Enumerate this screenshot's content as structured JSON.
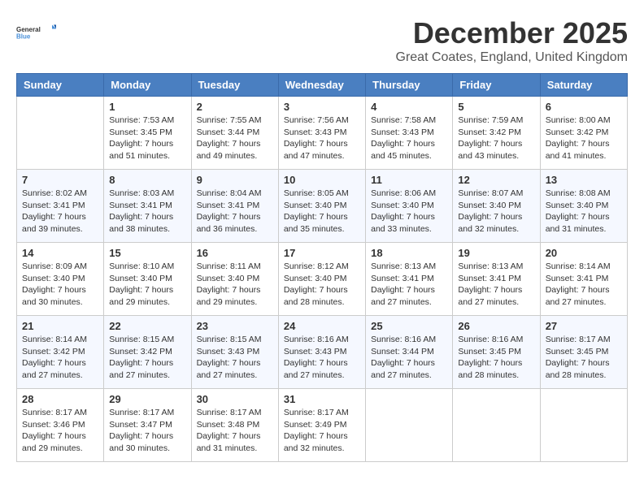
{
  "logo": {
    "text_general": "General",
    "text_blue": "Blue"
  },
  "header": {
    "title": "December 2025",
    "subtitle": "Great Coates, England, United Kingdom"
  },
  "weekdays": [
    "Sunday",
    "Monday",
    "Tuesday",
    "Wednesday",
    "Thursday",
    "Friday",
    "Saturday"
  ],
  "weeks": [
    [
      {
        "day": "",
        "info": ""
      },
      {
        "day": "1",
        "info": "Sunrise: 7:53 AM\nSunset: 3:45 PM\nDaylight: 7 hours\nand 51 minutes."
      },
      {
        "day": "2",
        "info": "Sunrise: 7:55 AM\nSunset: 3:44 PM\nDaylight: 7 hours\nand 49 minutes."
      },
      {
        "day": "3",
        "info": "Sunrise: 7:56 AM\nSunset: 3:43 PM\nDaylight: 7 hours\nand 47 minutes."
      },
      {
        "day": "4",
        "info": "Sunrise: 7:58 AM\nSunset: 3:43 PM\nDaylight: 7 hours\nand 45 minutes."
      },
      {
        "day": "5",
        "info": "Sunrise: 7:59 AM\nSunset: 3:42 PM\nDaylight: 7 hours\nand 43 minutes."
      },
      {
        "day": "6",
        "info": "Sunrise: 8:00 AM\nSunset: 3:42 PM\nDaylight: 7 hours\nand 41 minutes."
      }
    ],
    [
      {
        "day": "7",
        "info": "Sunrise: 8:02 AM\nSunset: 3:41 PM\nDaylight: 7 hours\nand 39 minutes."
      },
      {
        "day": "8",
        "info": "Sunrise: 8:03 AM\nSunset: 3:41 PM\nDaylight: 7 hours\nand 38 minutes."
      },
      {
        "day": "9",
        "info": "Sunrise: 8:04 AM\nSunset: 3:41 PM\nDaylight: 7 hours\nand 36 minutes."
      },
      {
        "day": "10",
        "info": "Sunrise: 8:05 AM\nSunset: 3:40 PM\nDaylight: 7 hours\nand 35 minutes."
      },
      {
        "day": "11",
        "info": "Sunrise: 8:06 AM\nSunset: 3:40 PM\nDaylight: 7 hours\nand 33 minutes."
      },
      {
        "day": "12",
        "info": "Sunrise: 8:07 AM\nSunset: 3:40 PM\nDaylight: 7 hours\nand 32 minutes."
      },
      {
        "day": "13",
        "info": "Sunrise: 8:08 AM\nSunset: 3:40 PM\nDaylight: 7 hours\nand 31 minutes."
      }
    ],
    [
      {
        "day": "14",
        "info": "Sunrise: 8:09 AM\nSunset: 3:40 PM\nDaylight: 7 hours\nand 30 minutes."
      },
      {
        "day": "15",
        "info": "Sunrise: 8:10 AM\nSunset: 3:40 PM\nDaylight: 7 hours\nand 29 minutes."
      },
      {
        "day": "16",
        "info": "Sunrise: 8:11 AM\nSunset: 3:40 PM\nDaylight: 7 hours\nand 29 minutes."
      },
      {
        "day": "17",
        "info": "Sunrise: 8:12 AM\nSunset: 3:40 PM\nDaylight: 7 hours\nand 28 minutes."
      },
      {
        "day": "18",
        "info": "Sunrise: 8:13 AM\nSunset: 3:41 PM\nDaylight: 7 hours\nand 27 minutes."
      },
      {
        "day": "19",
        "info": "Sunrise: 8:13 AM\nSunset: 3:41 PM\nDaylight: 7 hours\nand 27 minutes."
      },
      {
        "day": "20",
        "info": "Sunrise: 8:14 AM\nSunset: 3:41 PM\nDaylight: 7 hours\nand 27 minutes."
      }
    ],
    [
      {
        "day": "21",
        "info": "Sunrise: 8:14 AM\nSunset: 3:42 PM\nDaylight: 7 hours\nand 27 minutes."
      },
      {
        "day": "22",
        "info": "Sunrise: 8:15 AM\nSunset: 3:42 PM\nDaylight: 7 hours\nand 27 minutes."
      },
      {
        "day": "23",
        "info": "Sunrise: 8:15 AM\nSunset: 3:43 PM\nDaylight: 7 hours\nand 27 minutes."
      },
      {
        "day": "24",
        "info": "Sunrise: 8:16 AM\nSunset: 3:43 PM\nDaylight: 7 hours\nand 27 minutes."
      },
      {
        "day": "25",
        "info": "Sunrise: 8:16 AM\nSunset: 3:44 PM\nDaylight: 7 hours\nand 27 minutes."
      },
      {
        "day": "26",
        "info": "Sunrise: 8:16 AM\nSunset: 3:45 PM\nDaylight: 7 hours\nand 28 minutes."
      },
      {
        "day": "27",
        "info": "Sunrise: 8:17 AM\nSunset: 3:45 PM\nDaylight: 7 hours\nand 28 minutes."
      }
    ],
    [
      {
        "day": "28",
        "info": "Sunrise: 8:17 AM\nSunset: 3:46 PM\nDaylight: 7 hours\nand 29 minutes."
      },
      {
        "day": "29",
        "info": "Sunrise: 8:17 AM\nSunset: 3:47 PM\nDaylight: 7 hours\nand 30 minutes."
      },
      {
        "day": "30",
        "info": "Sunrise: 8:17 AM\nSunset: 3:48 PM\nDaylight: 7 hours\nand 31 minutes."
      },
      {
        "day": "31",
        "info": "Sunrise: 8:17 AM\nSunset: 3:49 PM\nDaylight: 7 hours\nand 32 minutes."
      },
      {
        "day": "",
        "info": ""
      },
      {
        "day": "",
        "info": ""
      },
      {
        "day": "",
        "info": ""
      }
    ]
  ]
}
